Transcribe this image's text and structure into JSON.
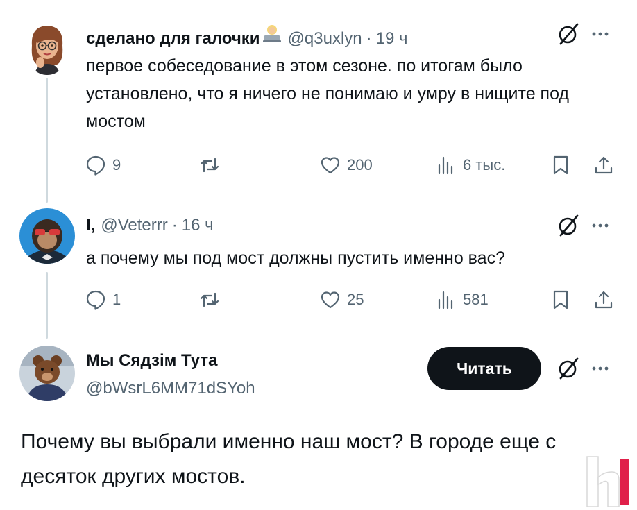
{
  "tweets": [
    {
      "display_name": "сделано для галочки",
      "handle": "@q3uxlyn",
      "separator": "·",
      "time": "19 ч",
      "text": "первое собеседование в этом сезоне. по итогам было установлено, что я ничего не понимаю и умру в нищите под мостом",
      "replies": "9",
      "likes": "200",
      "views": "6 тыс."
    },
    {
      "display_name": "I,",
      "handle": "@Veterrr",
      "separator": "·",
      "time": "16 ч",
      "text": "а почему мы под мост должны пустить именно вас?",
      "replies": "1",
      "likes": "25",
      "views": "581"
    }
  ],
  "main_tweet": {
    "display_name": "Мы Сядзім Тута",
    "handle": "@bWsrL6MM71dSYoh",
    "follow_label": "Читать",
    "text": "Почему вы выбрали именно наш мост? В городе еще с десяток других мостов."
  },
  "icons": {
    "reply": "reply-bubble-icon",
    "repost": "repost-icon",
    "like": "heart-icon",
    "views": "views-bar-icon",
    "bookmark": "bookmark-icon",
    "share": "share-icon",
    "grok": "grok-slash-icon",
    "more": "more-dots-icon",
    "watermark": "h-logo-watermark"
  },
  "colors": {
    "text": "#0f1419",
    "secondary": "#536471",
    "thread_line": "#cfd9de",
    "follow_button": "#0f1419"
  }
}
